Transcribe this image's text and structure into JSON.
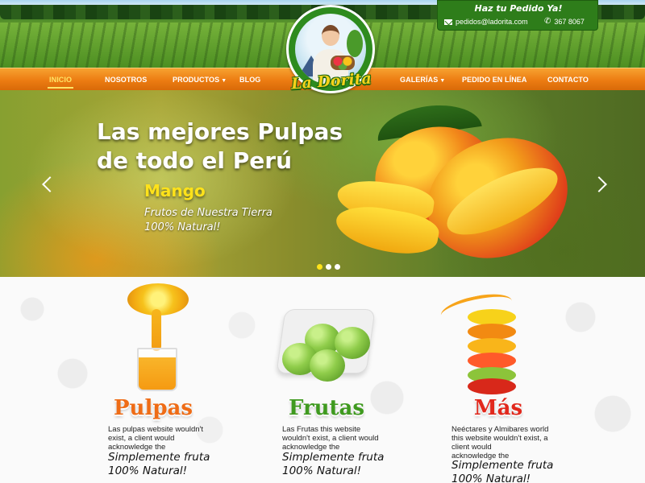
{
  "header": {
    "order_title": "Haz tu Pedido Ya!",
    "email": "pedidos@ladorita.com",
    "phone": "367 8067",
    "logo_text": "La Dorita"
  },
  "nav": {
    "items": [
      {
        "label": "INICIO",
        "active": true
      },
      {
        "label": "NOSOTROS"
      },
      {
        "label": "PRODUCTOS",
        "dropdown": true
      },
      {
        "label": "BLOG"
      },
      {
        "label": "GALERÍAS",
        "dropdown": true
      },
      {
        "label": "PEDIDO EN LÍNEA"
      },
      {
        "label": "CONTACTO"
      }
    ]
  },
  "hero": {
    "title_line1": "Las mejores Pulpas",
    "title_line2": "de todo el Perú",
    "subtitle": "Mango",
    "desc_line1": "Frutos de Nuestra Tierra",
    "desc_line2": "100% Natural!",
    "slide_count": 3,
    "active_slide": 1
  },
  "features": [
    {
      "title": "Pulpas",
      "title_color": "#ef6c16",
      "text_line1": "Las pulpas website wouldn't",
      "text_line2": "exist, a client would",
      "text_line3": "acknowledge the",
      "tag_line1": "Simplemente fruta",
      "tag_line2": "100% Natural!"
    },
    {
      "title": "Frutas",
      "title_color": "#3f9a1f",
      "text_line1": "Las Frutas this website",
      "text_line2": "wouldn't exist, a client would",
      "text_line3": "acknowledge the",
      "tag_line1": "Simplemente fruta",
      "tag_line2": "100% Natural!"
    },
    {
      "title": "Más",
      "title_color": "#e2281c",
      "text_line1": "Neéctares y Almibares world",
      "text_line2": "this website wouldn't exist, a",
      "text_line3": "client would",
      "text_line4": "acknowledge the",
      "tag_line1": "Simplemente fruta",
      "tag_line2": "100% Natural!"
    }
  ],
  "colors": {
    "nav_bg": "#ec7c12",
    "nav_active": "#ffe566",
    "order_box": "#2e7d1a",
    "hero_accent": "#ffe21a"
  }
}
